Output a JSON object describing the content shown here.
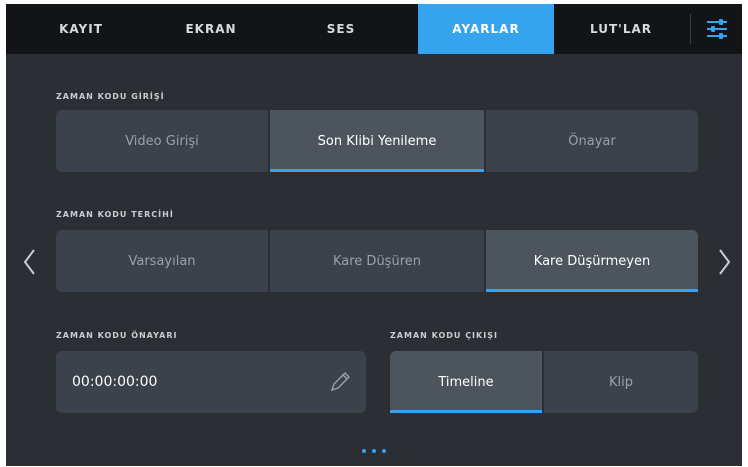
{
  "tabs": [
    {
      "label": "KAYIT"
    },
    {
      "label": "EKRAN"
    },
    {
      "label": "SES"
    },
    {
      "label": "AYARLAR"
    },
    {
      "label": "LUT'LAR"
    }
  ],
  "active_tab": "AYARLAR",
  "accent_color": "#35a3ee",
  "timecode_input": {
    "label": "ZAMAN KODU GİRİŞİ",
    "options": [
      "Video Girişi",
      "Son Klibi Yenileme",
      "Önayar"
    ],
    "selected": "Son Klibi Yenileme"
  },
  "timecode_preference": {
    "label": "ZAMAN KODU TERCİHİ",
    "options": [
      "Varsayılan",
      "Kare Düşüren",
      "Kare Düşürmeyen"
    ],
    "selected": "Kare Düşürmeyen"
  },
  "timecode_preset": {
    "label": "ZAMAN KODU ÖNAYARI",
    "value": "00:00:00:00"
  },
  "timecode_output": {
    "label": "ZAMAN KODU ÇIKIŞI",
    "options": [
      "Timeline",
      "Klip"
    ],
    "selected": "Timeline"
  },
  "icons": {
    "settings": "sliders-icon",
    "prev": "chevron-left-icon",
    "next": "chevron-right-icon",
    "edit": "pencil-icon"
  },
  "pagination": {
    "pages": 3
  }
}
